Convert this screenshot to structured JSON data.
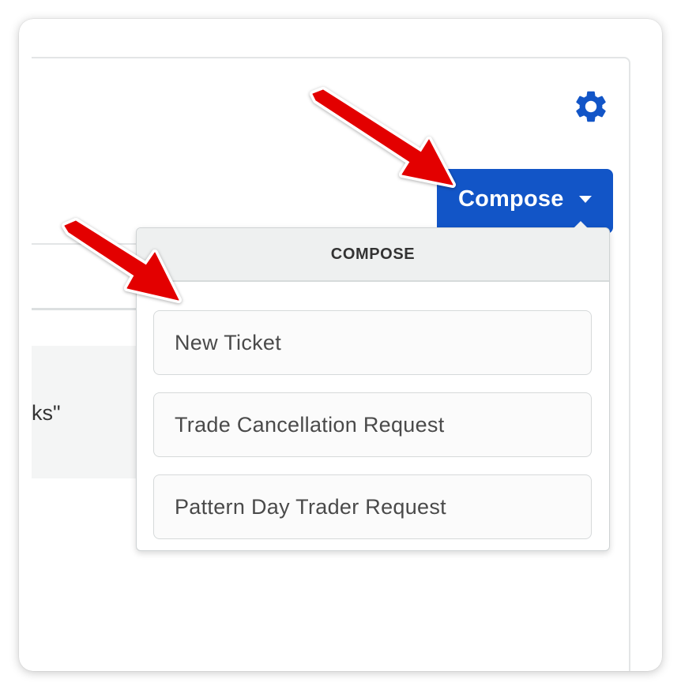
{
  "compose_button": {
    "label": "Compose",
    "color": "#1255c7"
  },
  "settings": {
    "icon": "gear-icon",
    "color": "#1255c7"
  },
  "background": {
    "partial_text": "ks\""
  },
  "dropdown": {
    "header": "COMPOSE",
    "items": [
      {
        "label": "New Ticket"
      },
      {
        "label": "Trade Cancellation Request"
      },
      {
        "label": "Pattern Day Trader Request"
      }
    ]
  },
  "annotations": {
    "arrow_color": "#e30000"
  }
}
